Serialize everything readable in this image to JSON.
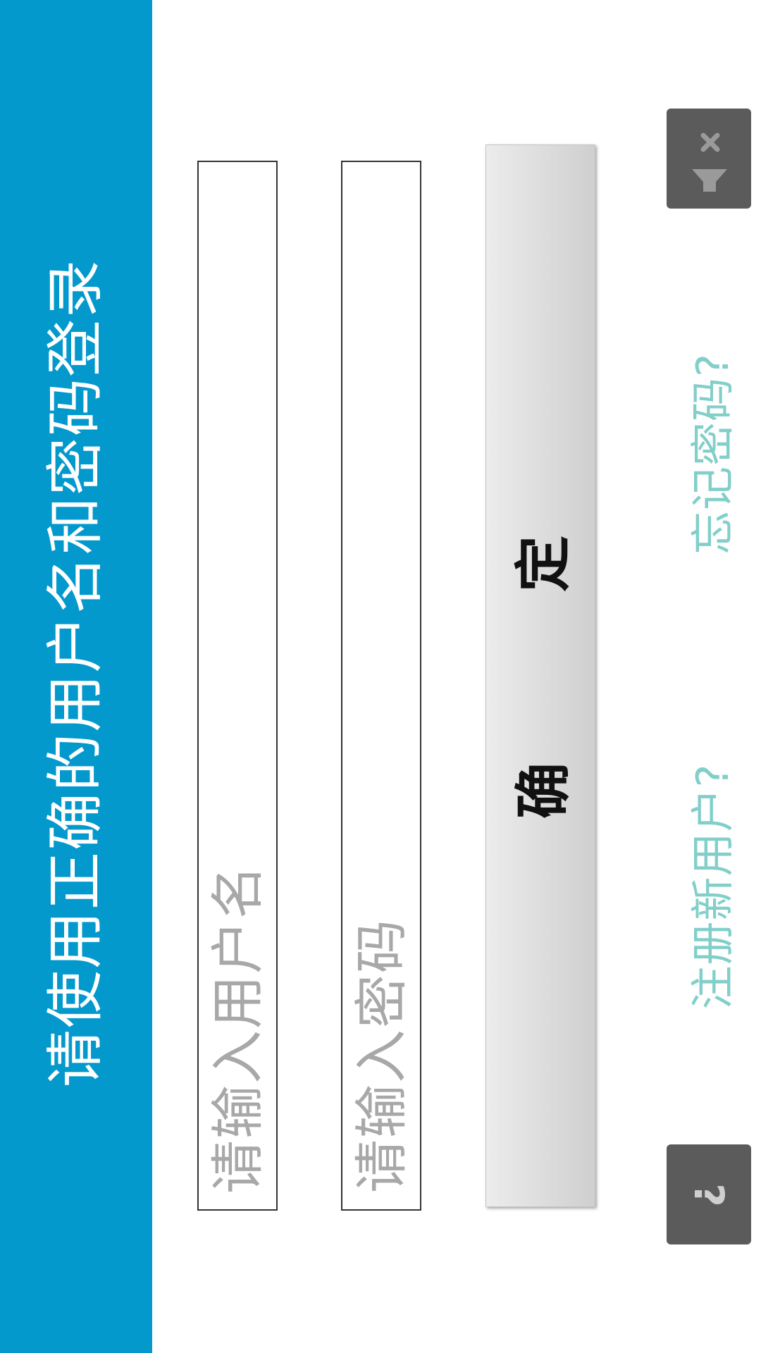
{
  "header": {
    "title": "请使用正确的用户名和密码登录"
  },
  "form": {
    "username_placeholder": "请输入用户名",
    "password_placeholder": "请输入密码",
    "confirm_char_1": "确",
    "confirm_char_2": "定"
  },
  "links": {
    "register": "注册新用户?",
    "forgot_password": "忘记密码?"
  },
  "icons": {
    "help": "help-icon",
    "close": "filter-clear-icon"
  },
  "colors": {
    "header_bg": "#0399cd",
    "link": "#82cfca",
    "placeholder": "#a8a8a8",
    "icon_button_bg": "#5b5b5c"
  }
}
